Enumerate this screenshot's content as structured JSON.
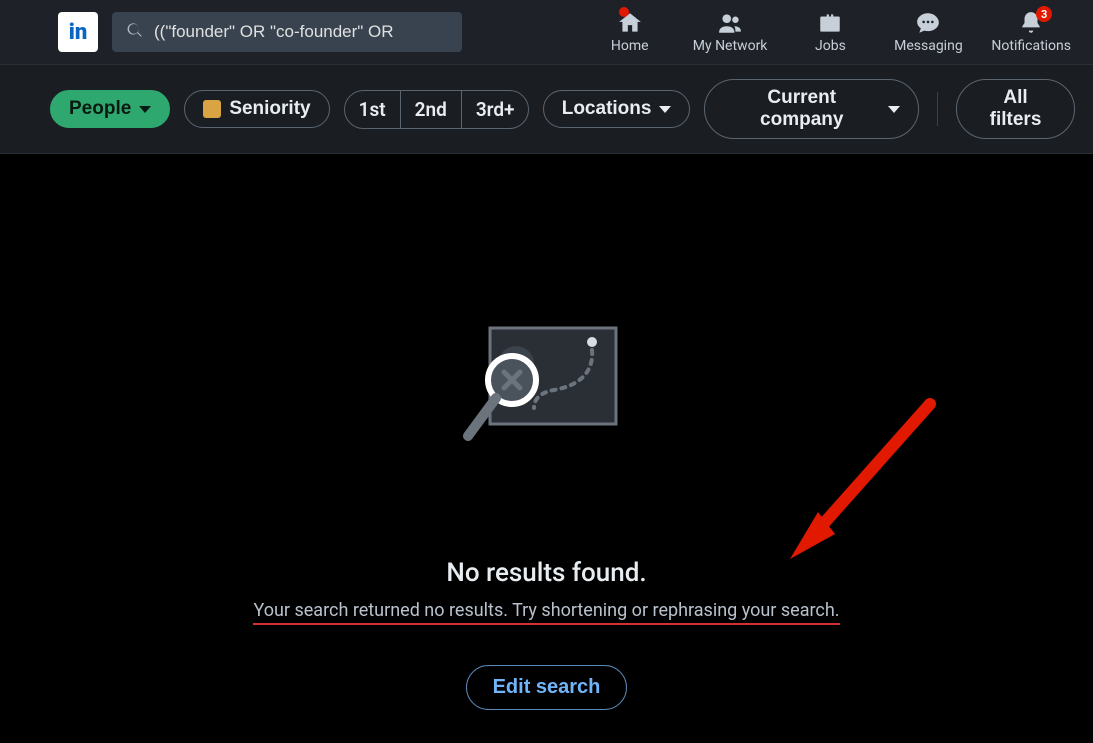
{
  "logo_text": "in",
  "search": {
    "value": "((\"founder\" OR \"co-founder\" OR"
  },
  "nav": {
    "home": "Home",
    "network": "My Network",
    "jobs": "Jobs",
    "messaging": "Messaging",
    "notifications": "Notifications",
    "notifications_badge": "3"
  },
  "filters": {
    "people": "People",
    "seniority": "Seniority",
    "conn1": "1st",
    "conn2": "2nd",
    "conn3": "3rd+",
    "locations": "Locations",
    "current_company": "Current company",
    "all_filters": "All filters"
  },
  "empty": {
    "title": "No results found.",
    "subtitle": "Your search returned no results. Try shortening or rephrasing your search.",
    "edit_button": "Edit search"
  },
  "colors": {
    "accent_green": "#2ea86f",
    "annotation_red": "#e11900"
  }
}
